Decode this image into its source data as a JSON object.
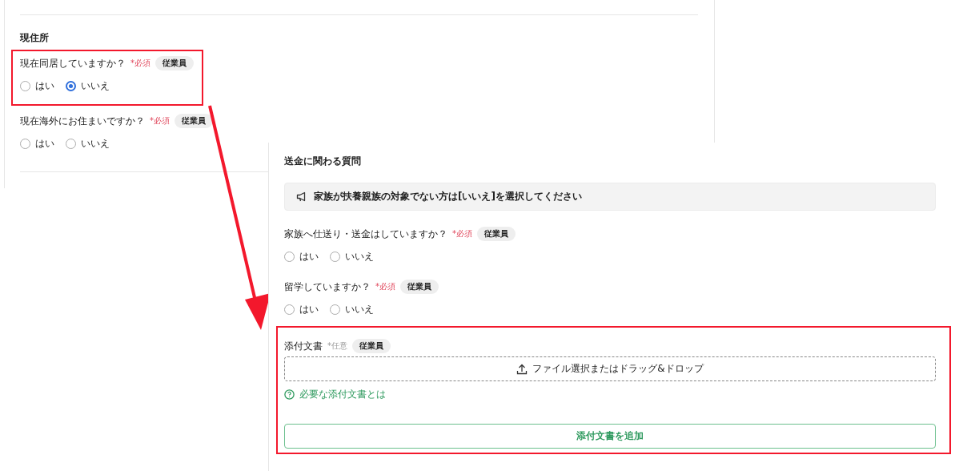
{
  "back_panel": {
    "section_title": "現住所",
    "questions": [
      {
        "label": "現在同居していますか？",
        "required_mark": "*必須",
        "tag": "従業員",
        "options": [
          {
            "label": "はい",
            "selected": false
          },
          {
            "label": "いいえ",
            "selected": true
          }
        ]
      },
      {
        "label": "現在海外にお住まいですか？",
        "required_mark": "*必須",
        "tag": "従業員",
        "options": [
          {
            "label": "はい",
            "selected": false
          },
          {
            "label": "いいえ",
            "selected": false
          }
        ]
      }
    ]
  },
  "front_panel": {
    "section_title": "送金に関わる質問",
    "notice": "家族が扶養親族の対象でない方は[いいえ]を選択してください",
    "questions": [
      {
        "label": "家族へ仕送り・送金はしていますか？",
        "required_mark": "*必須",
        "tag": "従業員",
        "options": [
          {
            "label": "はい",
            "selected": false
          },
          {
            "label": "いいえ",
            "selected": false
          }
        ]
      },
      {
        "label": "留学していますか？",
        "required_mark": "*必須",
        "tag": "従業員",
        "options": [
          {
            "label": "はい",
            "selected": false
          },
          {
            "label": "いいえ",
            "selected": false
          }
        ]
      }
    ],
    "attachment": {
      "label": "添付文書",
      "optional_mark": "*任意",
      "tag": "従業員",
      "dropzone": "ファイル選択またはドラッグ&ドロップ",
      "help_link": "必要な添付文書とは",
      "add_button": "添付文書を追加"
    }
  }
}
